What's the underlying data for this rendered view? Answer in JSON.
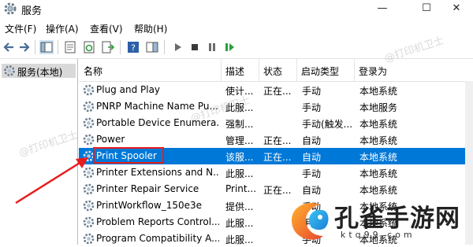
{
  "window": {
    "title": "服务"
  },
  "menu": [
    "文件(F)",
    "操作(A)",
    "查看(V)",
    "帮助(H)"
  ],
  "toolbar_icons": [
    "back-arrow",
    "forward-arrow",
    "console-tree",
    "properties",
    "refresh",
    "export-list",
    "help",
    "action-pane",
    "start",
    "stop",
    "pause",
    "resume"
  ],
  "tree": {
    "label": "服务(本地)"
  },
  "columns": [
    "名称",
    "描述",
    "状态",
    "启动类型",
    "登录为"
  ],
  "rows": [
    {
      "name": "Plug and Play",
      "desc": "使计...",
      "status": "正在...",
      "startup": "手动",
      "logon": "本地系统"
    },
    {
      "name": "PNRP Machine Name Pu...",
      "desc": "此服...",
      "status": "",
      "startup": "手动",
      "logon": "本地服务"
    },
    {
      "name": "Portable Device Enumera...",
      "desc": "强制...",
      "status": "",
      "startup": "手动(触发...",
      "logon": "本地系统"
    },
    {
      "name": "Power",
      "desc": "管理...",
      "status": "正在...",
      "startup": "自动",
      "logon": "本地系统"
    },
    {
      "name": "Print Spooler",
      "desc": "该服...",
      "status": "正在...",
      "startup": "自动",
      "logon": "本地系统"
    },
    {
      "name": "Printer Extensions and N...",
      "desc": "此服...",
      "status": "",
      "startup": "手动",
      "logon": "本地系统"
    },
    {
      "name": "Printer Repair Service",
      "desc": "Print...",
      "status": "正在...",
      "startup": "自动",
      "logon": "本地系统"
    },
    {
      "name": "PrintWorkflow_150e3e",
      "desc": "提供...",
      "status": "",
      "startup": "手动",
      "logon": "本地系统"
    },
    {
      "name": "Problem Reports Control...",
      "desc": "此服...",
      "status": "",
      "startup": "手动",
      "logon": "本地系统"
    },
    {
      "name": "Program Compatibility A...",
      "desc": "此服...",
      "status": "",
      "startup": "手动",
      "logon": "本地系统"
    }
  ],
  "selected_row_index": 4,
  "watermark": "@打印机卫士",
  "brand": {
    "name": "孔雀手游网",
    "url": "ktq99.com"
  },
  "colors": {
    "selection": "#0078d7",
    "highlight_box": "#e81c1c",
    "arrow": "#e81c1c"
  }
}
